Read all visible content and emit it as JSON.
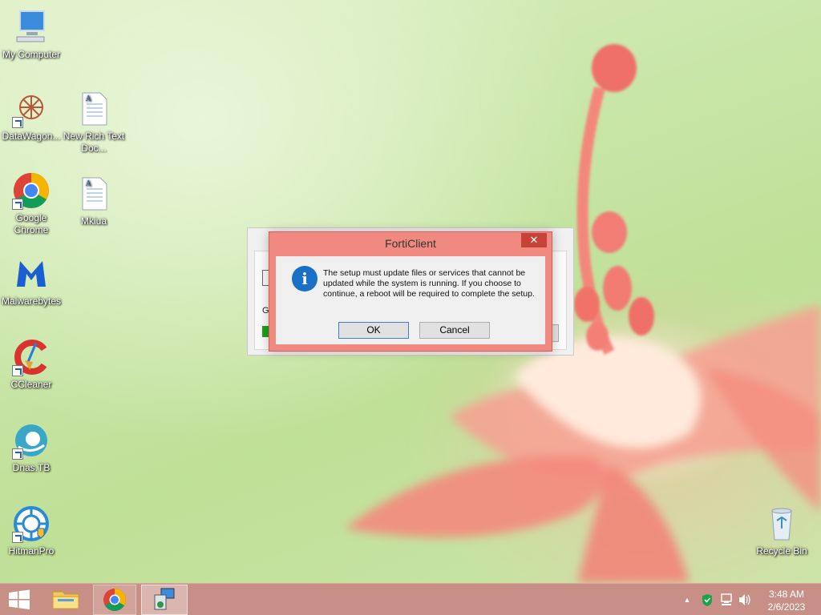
{
  "desktop": {
    "icons": [
      {
        "label": "My Computer"
      },
      {
        "label": "DataWagon..."
      },
      {
        "label": "New Rich Text Doc..."
      },
      {
        "label": "Google Chrome"
      },
      {
        "label": "Mkiua"
      },
      {
        "label": "Malwarebytes"
      },
      {
        "label": "CCleaner"
      },
      {
        "label": "Dnas.TB"
      },
      {
        "label": "HitmanPro"
      },
      {
        "label": "Recycle Bin"
      }
    ]
  },
  "installer_window": {
    "partial_label": "G"
  },
  "dialog": {
    "title": "FortiClient",
    "close_glyph": "✕",
    "icon": "info-icon",
    "message": "The setup must update files or services that cannot be updated while the system is running. If you choose to continue, a reboot will be required to complete the setup.",
    "ok_label": "OK",
    "cancel_label": "Cancel"
  },
  "taskbar": {
    "items": [
      {
        "name": "start-button",
        "icon": "windows-logo-icon"
      },
      {
        "name": "file-explorer",
        "icon": "folder-icon"
      },
      {
        "name": "google-chrome",
        "icon": "chrome-icon"
      },
      {
        "name": "setup-program",
        "icon": "installer-icon"
      }
    ],
    "tray_chevron": "▲",
    "clock_time": "3:48 AM",
    "clock_date": "2/6/2023"
  },
  "colors": {
    "taskbar": "#c88f86",
    "dialog_frame": "#f08a80",
    "close_button": "#c7433a",
    "info_icon": "#1a70c6"
  }
}
